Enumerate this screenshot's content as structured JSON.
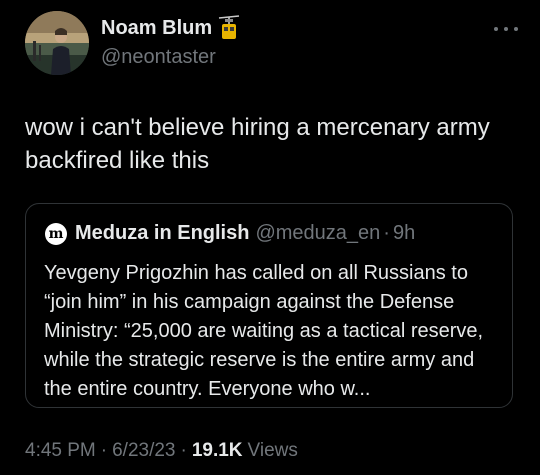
{
  "author": {
    "display_name": "Noam Blum",
    "handle": "@neontaster",
    "badge_icon": "cable-car-icon"
  },
  "tweet": {
    "text": "wow i can't believe hiring a mercenary army backfired like this"
  },
  "quote": {
    "avatar_letter": "m",
    "name": "Meduza in English",
    "handle": "@meduza_en",
    "separator": "·",
    "time": "9h",
    "text": "Yevgeny Prigozhin has called on all Russians to “join him” in his campaign against the Defense Ministry: “25,000 are waiting as a tactical reserve, while the strategic reserve is the entire army and the entire country. Everyone who w..."
  },
  "meta": {
    "time": "4:45 PM",
    "separator": "·",
    "date": "6/23/23",
    "views_count": "19.1K",
    "views_label": "Views"
  },
  "colors": {
    "background": "#000000",
    "text_primary": "#e7e9ea",
    "text_secondary": "#71767b",
    "border": "#2f3336"
  }
}
